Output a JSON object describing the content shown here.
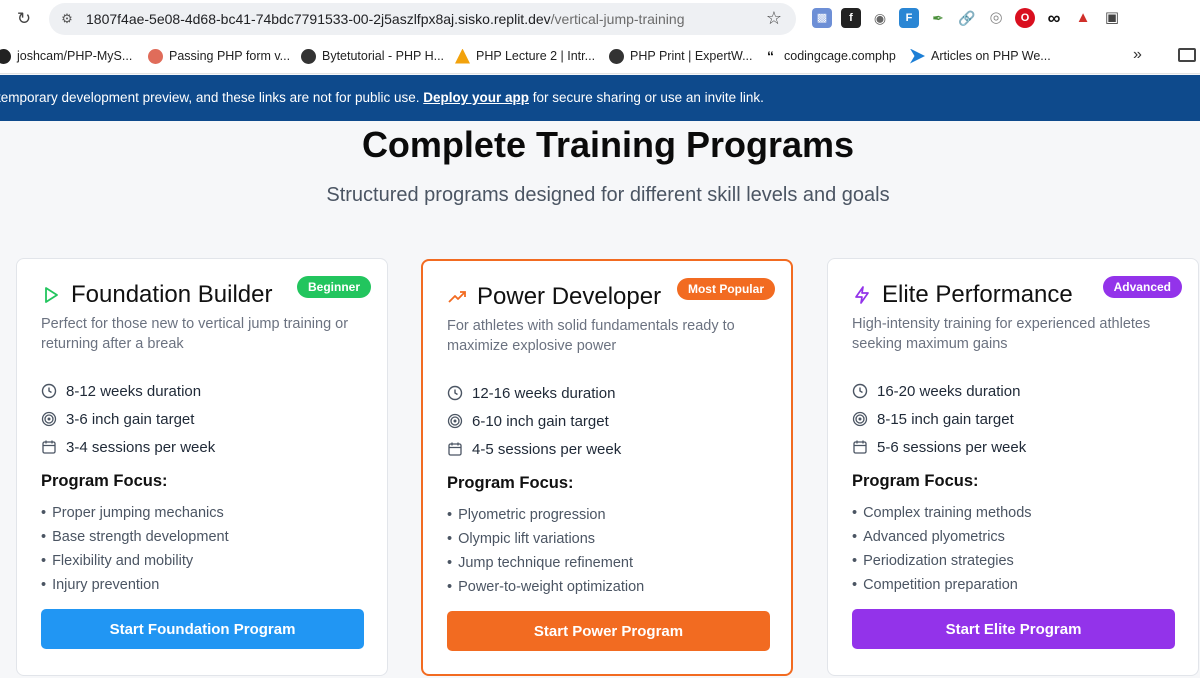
{
  "browser": {
    "url_host": "1807f4ae-5e08-4d68-bc41-74bdc7791533-00-2j5aszlfpx8aj.sisko.replit.dev",
    "url_path": "/vertical-jump-training",
    "bookmarks": [
      {
        "label": "joshcam/PHP-MyS...",
        "icon": "github-icon",
        "color": "#222222"
      },
      {
        "label": "Passing PHP form v...",
        "icon": "php-site-icon",
        "color": "#e06c5a"
      },
      {
        "label": "Bytetutorial - PHP H...",
        "icon": "globe-icon",
        "color": "#333333"
      },
      {
        "label": "PHP Lecture 2 | Intr...",
        "icon": "drive-icon",
        "color": "#f2a20c"
      },
      {
        "label": "PHP Print | ExpertW...",
        "icon": "globe-icon",
        "color": "#333333"
      },
      {
        "label": "codingcage.comphp",
        "icon": "quote-icon",
        "color": "#111111"
      },
      {
        "label": "Articles on PHP We...",
        "icon": "chevron-site-icon",
        "color": "#1d7fd6"
      }
    ]
  },
  "banner": {
    "text_before": "temporary development preview, and these links are not for public use.",
    "link": "Deploy your app",
    "text_after": "for secure sharing or use an invite link."
  },
  "page": {
    "title": "Complete Training Programs",
    "subtitle": "Structured programs designed for different skill levels and goals"
  },
  "programs": [
    {
      "title": "Foundation Builder",
      "badge": "Beginner",
      "badge_color": "#22c55e",
      "icon": "play-icon",
      "accent": "#22c55e",
      "description": "Perfect for those new to vertical jump training or returning after a break",
      "duration": "8-12 weeks duration",
      "gain": "3-6 inch gain target",
      "sessions": "3-4 sessions per week",
      "focus_title": "Program Focus:",
      "focus": [
        "Proper jumping mechanics",
        "Base strength development",
        "Flexibility and mobility",
        "Injury prevention"
      ],
      "button": "Start Foundation Program",
      "button_color": "#2196f3"
    },
    {
      "title": "Power Developer",
      "badge": "Most Popular",
      "badge_color": "#f26b21",
      "icon": "trending-up-icon",
      "accent": "#f26b21",
      "description": "For athletes with solid fundamentals ready to maximize explosive power",
      "duration": "12-16 weeks duration",
      "gain": "6-10 inch gain target",
      "sessions": "4-5 sessions per week",
      "focus_title": "Program Focus:",
      "focus": [
        "Plyometric progression",
        "Olympic lift variations",
        "Jump technique refinement",
        "Power-to-weight optimization"
      ],
      "button": "Start Power Program",
      "button_color": "#f26b21"
    },
    {
      "title": "Elite Performance",
      "badge": "Advanced",
      "badge_color": "#9333ea",
      "icon": "lightning-icon",
      "accent": "#9333ea",
      "description": "High-intensity training for experienced athletes seeking maximum gains",
      "duration": "16-20 weeks duration",
      "gain": "8-15 inch gain target",
      "sessions": "5-6 sessions per week",
      "focus_title": "Program Focus:",
      "focus": [
        "Complex training methods",
        "Advanced plyometrics",
        "Periodization strategies",
        "Competition preparation"
      ],
      "button": "Start Elite Program",
      "button_color": "#9333ea"
    }
  ]
}
